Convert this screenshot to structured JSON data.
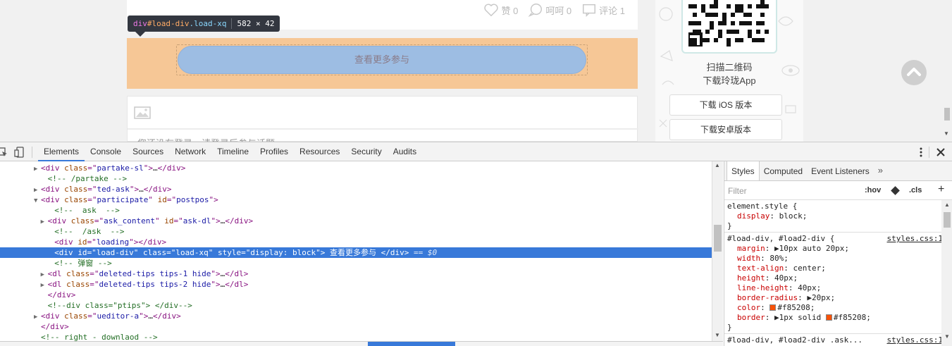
{
  "page": {
    "actions": [
      {
        "icon": "heart-icon",
        "label": "赞 0"
      },
      {
        "icon": "speech-icon",
        "label": "呵呵 0"
      },
      {
        "icon": "comment-icon",
        "label": "评论 1"
      }
    ],
    "load_more_label": "查看更多参与",
    "login_hint": "您还没有登录，请登录后参与话题",
    "tooltip": {
      "tag": "div",
      "id": "#load-div",
      "cls": ".load-xq",
      "size": "582 × 42"
    },
    "sidebar": {
      "qr_caption": "扫描二维码",
      "download_app": "下载玲珑App",
      "ios_button": "下载 iOS 版本",
      "android_button": "下载安卓版本"
    }
  },
  "devtools": {
    "tabs": [
      "Elements",
      "Console",
      "Sources",
      "Network",
      "Timeline",
      "Profiles",
      "Resources",
      "Security",
      "Audits"
    ],
    "dom": [
      {
        "indent": 5,
        "tri": "▶",
        "parts": [
          [
            "t",
            "<div "
          ],
          [
            "a",
            "class"
          ],
          [
            "t",
            "=\""
          ],
          [
            "v",
            "partake-sl"
          ],
          [
            "t",
            "\">"
          ],
          [
            "x",
            "…"
          ],
          [
            "t",
            "</div>"
          ]
        ]
      },
      {
        "indent": 6,
        "tri": "",
        "parts": [
          [
            "c",
            "<!-- /partake -->"
          ]
        ]
      },
      {
        "indent": 5,
        "tri": "▶",
        "parts": [
          [
            "t",
            "<div "
          ],
          [
            "a",
            "class"
          ],
          [
            "t",
            "=\""
          ],
          [
            "v",
            "ted-ask"
          ],
          [
            "t",
            "\">"
          ],
          [
            "x",
            "…"
          ],
          [
            "t",
            "</div>"
          ]
        ]
      },
      {
        "indent": 5,
        "tri": "▼",
        "parts": [
          [
            "t",
            "<div "
          ],
          [
            "a",
            "class"
          ],
          [
            "t",
            "=\""
          ],
          [
            "v",
            "participate"
          ],
          [
            "t",
            "\" "
          ],
          [
            "a",
            "id"
          ],
          [
            "t",
            "=\""
          ],
          [
            "v",
            "postpos"
          ],
          [
            "t",
            "\">"
          ]
        ]
      },
      {
        "indent": 7,
        "tri": "",
        "parts": [
          [
            "c",
            "<!--  ask  -->"
          ]
        ]
      },
      {
        "indent": 6,
        "tri": "▶",
        "parts": [
          [
            "t",
            "<div "
          ],
          [
            "a",
            "class"
          ],
          [
            "t",
            "=\""
          ],
          [
            "v",
            "ask_content"
          ],
          [
            "t",
            "\" "
          ],
          [
            "a",
            "id"
          ],
          [
            "t",
            "=\""
          ],
          [
            "v",
            "ask-dl"
          ],
          [
            "t",
            "\">"
          ],
          [
            "x",
            "…"
          ],
          [
            "t",
            "</div>"
          ]
        ]
      },
      {
        "indent": 7,
        "tri": "",
        "parts": [
          [
            "c",
            "<!--  /ask  -->"
          ]
        ]
      },
      {
        "indent": 7,
        "tri": "",
        "parts": [
          [
            "t",
            "<div "
          ],
          [
            "a",
            "id"
          ],
          [
            "t",
            "=\""
          ],
          [
            "v",
            "loading"
          ],
          [
            "t",
            "\">"
          ],
          [
            "t",
            "</div>"
          ]
        ]
      },
      {
        "indent": 7,
        "tri": "",
        "selected": true,
        "parts": [
          [
            "t",
            "<div "
          ],
          [
            "a",
            "id"
          ],
          [
            "t",
            "=\""
          ],
          [
            "v",
            "load-div"
          ],
          [
            "t",
            "\" "
          ],
          [
            "a",
            "class"
          ],
          [
            "t",
            "=\""
          ],
          [
            "v",
            "load-xq"
          ],
          [
            "t",
            "\" "
          ],
          [
            "a",
            "style"
          ],
          [
            "t",
            "=\""
          ],
          [
            "v",
            "display: block"
          ],
          [
            "t",
            "\">"
          ],
          [
            "x",
            " 查看更多参与 "
          ],
          [
            "t",
            "</div>"
          ],
          [
            "eq",
            " == $0"
          ]
        ]
      },
      {
        "indent": 7,
        "tri": "",
        "parts": [
          [
            "c",
            "<!-- 弹窗 -->"
          ]
        ]
      },
      {
        "indent": 6,
        "tri": "▶",
        "parts": [
          [
            "t",
            "<dl "
          ],
          [
            "a",
            "class"
          ],
          [
            "t",
            "=\""
          ],
          [
            "v",
            "deleted-tips tips-1 hide"
          ],
          [
            "t",
            "\">"
          ],
          [
            "x",
            "…"
          ],
          [
            "t",
            "</dl>"
          ]
        ]
      },
      {
        "indent": 6,
        "tri": "▶",
        "parts": [
          [
            "t",
            "<dl "
          ],
          [
            "a",
            "class"
          ],
          [
            "t",
            "=\""
          ],
          [
            "v",
            "deleted-tips tips-2 hide"
          ],
          [
            "t",
            "\">"
          ],
          [
            "x",
            "…"
          ],
          [
            "t",
            "</dl>"
          ]
        ]
      },
      {
        "indent": 6,
        "tri": "",
        "parts": [
          [
            "t",
            "</div>"
          ]
        ]
      },
      {
        "indent": 6,
        "tri": "",
        "parts": [
          [
            "c",
            "<!--div class=\"ptips\"> </div-->"
          ]
        ]
      },
      {
        "indent": 5,
        "tri": "▶",
        "parts": [
          [
            "t",
            "<div "
          ],
          [
            "a",
            "class"
          ],
          [
            "t",
            "=\""
          ],
          [
            "v",
            "ueditor-a"
          ],
          [
            "t",
            "\">"
          ],
          [
            "x",
            "…"
          ],
          [
            "t",
            "</div>"
          ]
        ]
      },
      {
        "indent": 5,
        "tri": "",
        "parts": [
          [
            "t",
            "</div>"
          ]
        ]
      },
      {
        "indent": 5,
        "tri": "",
        "parts": [
          [
            "c",
            "<!-- right - downlaod -->"
          ]
        ]
      }
    ],
    "styles_tabs": [
      "Styles",
      "Computed",
      "Event Listeners"
    ],
    "filter_placeholder": "Filter",
    "hov": ":hov",
    "cls": ".cls",
    "rules": [
      {
        "selector": "element.style {",
        "source": "",
        "props": [
          [
            "display",
            "block;"
          ]
        ]
      },
      {
        "selector": "#load-div, #load2-div {",
        "source": "styles.css:1",
        "props": [
          [
            "margin",
            "▶10px auto 20px;"
          ],
          [
            "width",
            "80%;"
          ],
          [
            "text-align",
            "center;"
          ],
          [
            "height",
            "40px;"
          ],
          [
            "line-height",
            "40px;"
          ],
          [
            "border-radius",
            "▶20px;"
          ],
          [
            "color",
            "#f85208;"
          ],
          [
            "border",
            "▶1px solid ■#f85208;"
          ]
        ]
      },
      {
        "selector": "#load-div, #load2-div .ask...",
        "source": "styles.css:1",
        "props": []
      }
    ],
    "swatch_color": "#f85208"
  }
}
